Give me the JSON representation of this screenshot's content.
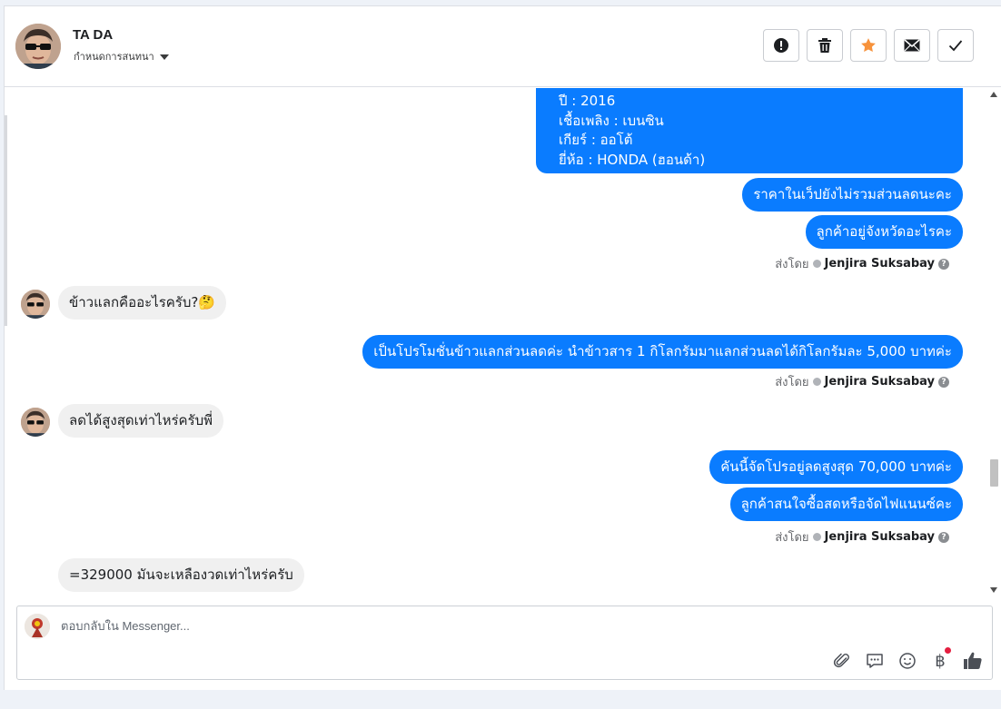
{
  "header": {
    "contact_name": "TA DA",
    "assign_label": "กำหนดการสนทนา",
    "actions": [
      {
        "name": "report-button",
        "icon": "exclamation-icon"
      },
      {
        "name": "delete-button",
        "icon": "trash-icon"
      },
      {
        "name": "star-button",
        "icon": "star-icon"
      },
      {
        "name": "mark-unread-button",
        "icon": "envelope-icon"
      },
      {
        "name": "mark-done-button",
        "icon": "check-icon"
      }
    ]
  },
  "messages": {
    "spec_lines": [
      "ปี : 2016",
      "เชื้อเพลิง : เบนซิน",
      "เกียร์ : ออโต้",
      "ยี่ห้อ : HONDA (ฮอนด้า)"
    ],
    "out1": "ราคาในเว็ปยังไม่รวมส่วนลดนะคะ",
    "out2": "ลูกค้าอยู่จังหวัดอะไรคะ",
    "in1": "ข้าวแลกคืออะไรครับ?🤔",
    "out3": "เป็นโปรโมชั่นข้าวแลกส่วนลดค่ะ นำข้าวสาร 1 กิโลกรัมมาแลกส่วนลดได้กิโลกรัมละ 5,000 บาทค่ะ",
    "in2": "ลดได้สูงสุดเท่าไหร่ครับพี่",
    "out4": "คันนี้จัดโปรอยู่ลดสูงสุด 70,000 บาทค่ะ",
    "out5": "ลูกค้าสนใจซื้อสดหรือจัดไฟแนนซ์คะ",
    "in3": "=329000 มันจะเหลืองวดเท่าไหร่ครับ",
    "sent_by_label": "ส่งโดย",
    "sent_by_name": "Jenjira Suksabay",
    "help_glyph": "?"
  },
  "composer": {
    "placeholder": "ตอบกลับใน Messenger...",
    "value": "",
    "baht_glyph": "฿"
  },
  "colors": {
    "outgoing_bubble": "#0a7cff",
    "incoming_bubble": "#f0f0f0",
    "star": "#f7923b",
    "like": "#4b4f56"
  }
}
